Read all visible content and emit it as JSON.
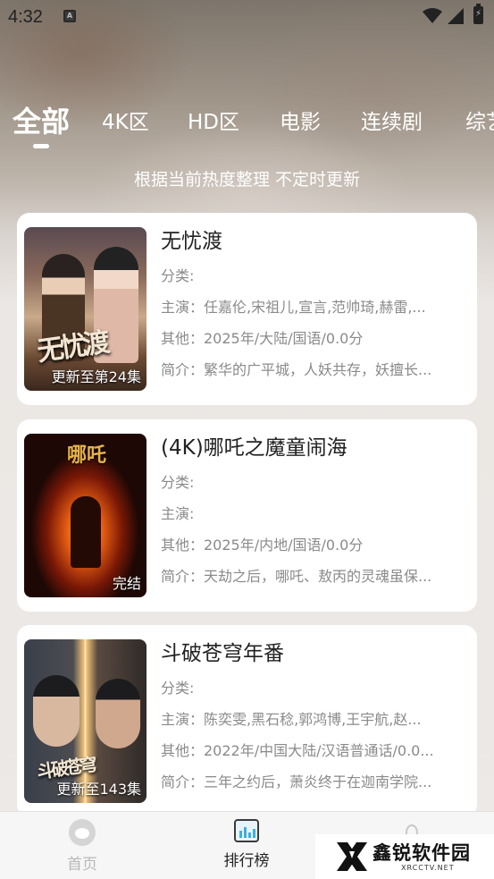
{
  "status_bar": {
    "time": "4:32",
    "notification_icon": "A"
  },
  "tabs": [
    "全部",
    "4K区",
    "HD区",
    "电影",
    "连续剧",
    "综艺"
  ],
  "subtitle": "根据当前热度整理 不定时更新",
  "items": [
    {
      "title": "无忧渡",
      "category": "分类:",
      "cast": "主演：任嘉伦,宋祖儿,宣言,范帅琦,赫雷,...",
      "other": "其他：2025年/大陆/国语/0.0分",
      "intro": "简介：繁华的广平城，人妖共存，妖擅长...",
      "badge": "更新至第24集",
      "poster_text": "无忧渡"
    },
    {
      "title": "(4K)哪吒之魔童闹海",
      "category": "分类:",
      "cast": "主演:",
      "other": "其他：2025年/内地/国语/0.0分",
      "intro": "简介：天劫之后，哪吒、敖丙的灵魂虽保...",
      "badge": "完结",
      "poster_text": "哪吒"
    },
    {
      "title": "斗破苍穹年番",
      "category": "分类:",
      "cast": "主演：陈奕雯,黑石稔,郭鸿博,王宇航,赵...",
      "other": "其他：2022年/中国大陆/汉语普通话/0.0...",
      "intro": "简介：三年之约后，萧炎终于在迦南学院...",
      "badge": "更新至143集",
      "poster_text": "斗破苍穹"
    }
  ],
  "bottom_nav": {
    "home": "首页",
    "rank": "排行榜"
  },
  "watermark": {
    "name": "鑫锐软件园",
    "domain": "XRCCTV.NET"
  }
}
